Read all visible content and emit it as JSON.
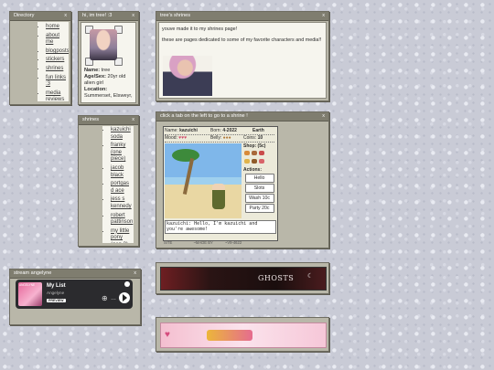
{
  "directory": {
    "title": "Directory",
    "close": "x",
    "items": [
      "home",
      "about me",
      "blogposts",
      "stickers",
      "shrines",
      "fun links :3",
      "media reviews",
      "music i like"
    ]
  },
  "profile": {
    "title": "hi, im tree! :3",
    "close": "x",
    "name_label": "Name:",
    "name_value": "tree",
    "age_label": "Age/Sex:",
    "age_value": "20yr old alien girl",
    "loc_label": "Location:",
    "loc_value": "Summerset, Elsweyr,"
  },
  "shrines_win": {
    "title": "tree's shrines",
    "close": "x",
    "line1": "youve made it to my shrines page!",
    "line2": "these are pages dedicated to some of my favorite characters and media!!"
  },
  "shrines_list": {
    "title": "shrines",
    "close": "x",
    "items": [
      "kazuichi soda",
      "franky (one piece)",
      "jacob black",
      "portgas d ace",
      "jess s kennedy",
      "robert pattinson",
      "my little pony (gen 3)"
    ]
  },
  "pet_win": {
    "title": "click a tab on the left to go to a shrine !",
    "close": "x",
    "name_label": "Name:",
    "name_value": "kazuichi",
    "born_label": "Born:",
    "born_value": "4-2022",
    "planet_value": "Earth",
    "mood_label": "Mood:",
    "belly_label": "Belly:",
    "coins_label": "Coins:",
    "coins_value": "10",
    "shop_label": "Shop: (5c)",
    "actions_label": "Actions:",
    "actions": [
      "Hello",
      "Slots",
      "Wash 10c",
      "Party 20c"
    ],
    "speech": "kazuichi: Hello, I'm kazuichi and you're awesome!",
    "footer_left": "SITE",
    "footer_mid": "~MADE BY",
    "footer_right": "~V9-4622"
  },
  "ghosts_banner": {
    "text": "GHOSTS"
  },
  "stream": {
    "title": "stream angelyne",
    "close": "x",
    "list_title": "My List",
    "artist": "Angelyne",
    "preview": "PREVIEW",
    "cover_text": "ANGELYNE"
  },
  "colors": {
    "window_frame": "#b9b7a9",
    "titlebar": "#7f7d6f",
    "panel": "#f6f5ee",
    "banner_dark": "#2a1414",
    "banner_pink": "#f6c7d8"
  }
}
